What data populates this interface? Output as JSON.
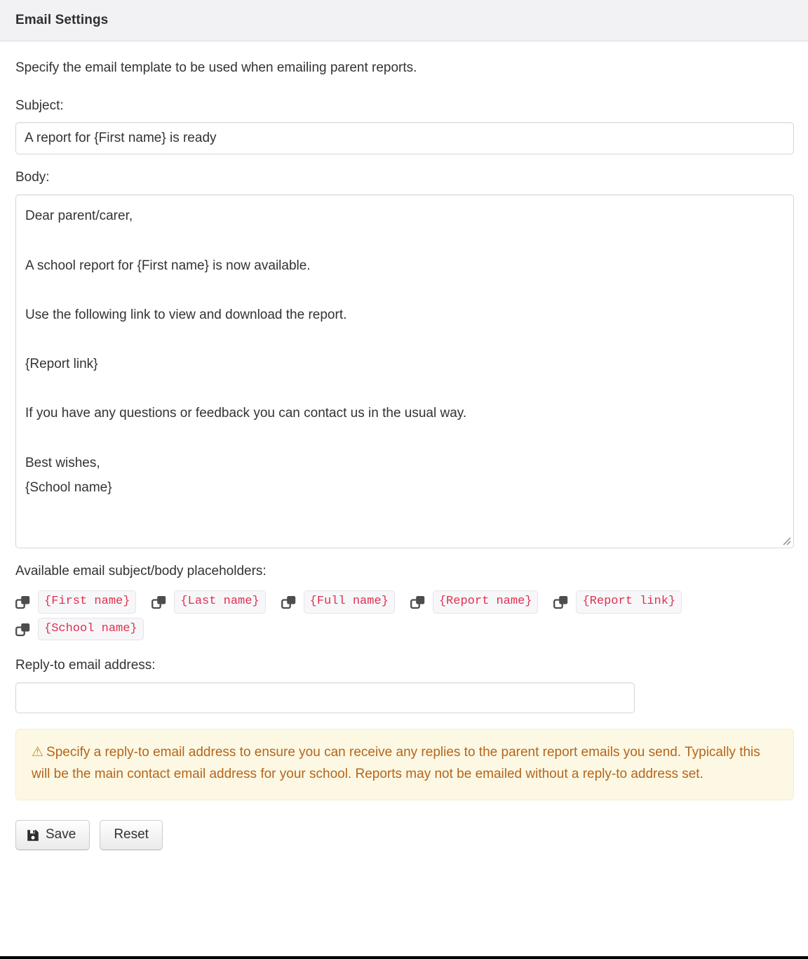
{
  "header": {
    "title": "Email Settings"
  },
  "main": {
    "intro": "Specify the email template to be used when emailing parent reports.",
    "subject": {
      "label": "Subject:",
      "value": "A report for {First name} is ready",
      "placeholder": ""
    },
    "body": {
      "label": "Body:",
      "value": "Dear parent/carer,\n\nA school report for {First name} is now available.\n\nUse the following link to view and download the report.\n\n{Report link}\n\nIf you have any questions or feedback you can contact us in the usual way.\n\nBest wishes,\n{School name}",
      "placeholder": ""
    },
    "placeholders": {
      "label": "Available email subject/body placeholders:",
      "copy_icon": "copy-icon",
      "items": [
        {
          "token": "{First name}"
        },
        {
          "token": "{Last name}"
        },
        {
          "token": "{Full name}"
        },
        {
          "token": "{Report name}"
        },
        {
          "token": "{Report link}"
        },
        {
          "token": "{School name}"
        }
      ]
    },
    "reply_to": {
      "label": "Reply-to email address:",
      "value": "",
      "placeholder": ""
    },
    "alert": {
      "icon": "warning-triangle-icon",
      "glyph": "⚠",
      "text": "Specify a reply-to email address to ensure you can receive any replies to the parent report emails you send. Typically this will be the main contact email address for your school. Reports may not be emailed without a reply-to address set."
    },
    "buttons": {
      "save_label": "Save",
      "save_icon": "save-floppy-icon",
      "reset_label": "Reset"
    }
  },
  "colors": {
    "code_text": "#e0304f",
    "code_bg": "#f7f7f9",
    "alert_bg": "#fcf8e3",
    "alert_text": "#b5651d",
    "header_bg": "#f2f2f4"
  }
}
